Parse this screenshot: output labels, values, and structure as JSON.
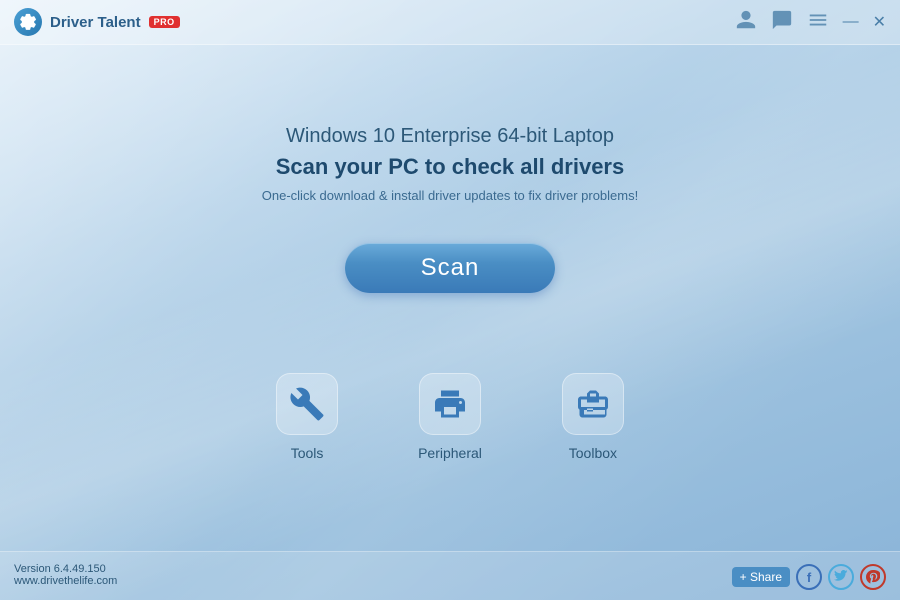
{
  "app": {
    "title": "Driver Talent",
    "pro_badge": "PRO",
    "icon_symbol": "⚙"
  },
  "titlebar": {
    "account_icon": "👤",
    "chat_icon": "💬",
    "list_icon": "☰",
    "minimize_label": "—",
    "close_label": "✕"
  },
  "main": {
    "system_line": "Windows 10 Enterprise 64-bit Laptop",
    "scan_prompt": "Scan your PC to check all drivers",
    "scan_sub": "One-click download & install driver updates to fix driver problems!",
    "scan_button_label": "Scan"
  },
  "bottom_icons": [
    {
      "id": "tools",
      "label": "Tools"
    },
    {
      "id": "peripheral",
      "label": "Peripheral"
    },
    {
      "id": "toolbox",
      "label": "Toolbox"
    }
  ],
  "footer": {
    "version": "Version 6.4.49.150",
    "website": "www.drivethelife.com",
    "share_label": "+ Share",
    "social": [
      "f",
      "t",
      "p"
    ]
  }
}
